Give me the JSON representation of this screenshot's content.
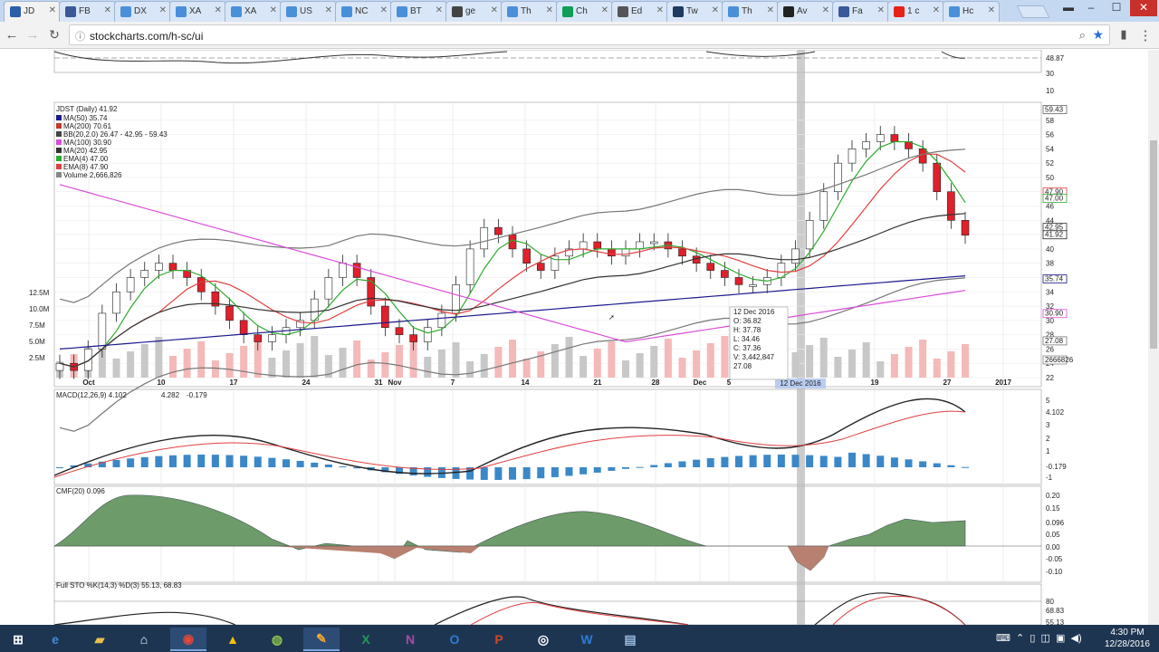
{
  "browser": {
    "tabs": [
      {
        "label": "JD",
        "color": "#2b5ea8",
        "active": true
      },
      {
        "label": "FB",
        "color": "#3b5998"
      },
      {
        "label": "DX",
        "color": "#4a90d9"
      },
      {
        "label": "XA",
        "color": "#4a90d9"
      },
      {
        "label": "XA",
        "color": "#4a90d9"
      },
      {
        "label": "US",
        "color": "#4a90d9"
      },
      {
        "label": "NC",
        "color": "#4a90d9"
      },
      {
        "label": "BT",
        "color": "#4a90d9"
      },
      {
        "label": "ge",
        "color": "#444444"
      },
      {
        "label": "Th",
        "color": "#4a90d9"
      },
      {
        "label": "Ch",
        "color": "#0f9d58"
      },
      {
        "label": "Ed",
        "color": "#555555"
      },
      {
        "label": "Tw",
        "color": "#1d3a5f"
      },
      {
        "label": "Th",
        "color": "#4a90d9"
      },
      {
        "label": "Av",
        "color": "#222222"
      },
      {
        "label": "Fa",
        "color": "#3b5998"
      },
      {
        "label": "1 c",
        "color": "#e62117"
      },
      {
        "label": "Hc",
        "color": "#4a90d9"
      }
    ],
    "url": "stockcharts.com/h-sc/ui",
    "back_icon": "arrow-left-icon",
    "forward_icon": "arrow-right-icon",
    "reload_icon": "reload-icon"
  },
  "chart_data": [
    {
      "type": "line",
      "title": "JDST (Daily) 41.92",
      "legend": [
        {
          "name": "MA(50) 35.74",
          "color": "#1a1a8c"
        },
        {
          "name": "MA(200) 70.61",
          "color": "#c0392b"
        },
        {
          "name": "BB(20,2.0) 26.47 - 42.95 - 59.43",
          "color": "#444444"
        },
        {
          "name": "MA(100) 30.90",
          "color": "#d94fd9"
        },
        {
          "name": "MA(20) 42.95",
          "color": "#333333"
        },
        {
          "name": "EMA(4) 47.00",
          "color": "#2eaa2e"
        },
        {
          "name": "EMA(8) 47.90",
          "color": "#e04040"
        },
        {
          "name": "Volume 2,666,826",
          "color": "#888888"
        }
      ],
      "x_ticks": [
        "Oct",
        "10",
        "17",
        "24",
        "31",
        "Nov",
        "7",
        "14",
        "21",
        "28",
        "Dec",
        "5",
        "12 Dec 2016",
        "19",
        "27",
        "2017"
      ],
      "y_ticks": [
        "22",
        "24",
        "26",
        "28",
        "30",
        "32",
        "34",
        "36",
        "38",
        "40",
        "42",
        "44",
        "46",
        "48",
        "50",
        "52",
        "54",
        "56",
        "58"
      ],
      "volume_ticks": [
        "2.5M",
        "5.0M",
        "7.5M",
        "10.0M",
        "12.5M"
      ],
      "right_badges": [
        "59.43",
        "47.90",
        "47.00",
        "42.95",
        "41.92",
        "35.74",
        "30.90",
        "27.08",
        "2666826"
      ],
      "upper_panel_ticks": [
        "48.87",
        "30",
        "10"
      ],
      "tooltip": {
        "date": "12 Dec 2016",
        "O": "36.82",
        "H": "37.78",
        "L": "34.46",
        "C": "37.36",
        "V": "3,442,847",
        "extra": "27.08"
      },
      "closes": [
        24,
        23,
        26,
        31,
        34,
        36,
        37,
        38,
        37,
        36,
        34,
        32,
        30,
        28,
        27,
        28,
        29,
        30,
        33,
        36,
        38,
        36,
        32,
        29,
        28,
        27,
        29,
        31,
        35,
        40,
        43,
        42,
        40,
        38,
        37,
        39,
        40,
        41,
        40,
        39,
        40,
        41,
        41,
        40,
        39,
        38,
        37,
        36,
        35,
        35,
        36,
        38,
        40,
        44,
        48,
        52,
        54,
        55,
        56,
        55,
        54,
        52,
        48,
        44,
        41.92
      ],
      "volume_label": "Volume 2,666,826"
    },
    {
      "type": "line",
      "title": "MACD(12,26,9) 4.102, 4.282, -0.179",
      "y_ticks": [
        "5",
        "4.102",
        "3",
        "2",
        "1",
        "-0.179",
        "-1"
      ],
      "series": [
        {
          "name": "MACD(12,26,9) 4.102",
          "color": "#222222"
        },
        {
          "name": "4.282",
          "color": "#e04040"
        },
        {
          "name": "-0.179",
          "color": "#3b88c8"
        }
      ]
    },
    {
      "type": "area",
      "title": "CMF(20) 0.096",
      "y_ticks": [
        "0.20",
        "0.15",
        "0.096",
        "0.05",
        "0.00",
        "-0.05",
        "-0.10"
      ]
    },
    {
      "type": "line",
      "title": "Full STO %K(14,3) %D(3) 55.13, 68.83",
      "y_ticks": [
        "80",
        "68.83",
        "55.13"
      ]
    }
  ],
  "taskbar": {
    "time": "4:30 PM",
    "date": "12/28/2016",
    "apps": [
      "start",
      "ie",
      "explorer",
      "home",
      "chrome",
      "drive",
      "android",
      "paint",
      "excel",
      "onenote",
      "outlook",
      "powerpoint",
      "obs",
      "word",
      "other"
    ]
  }
}
